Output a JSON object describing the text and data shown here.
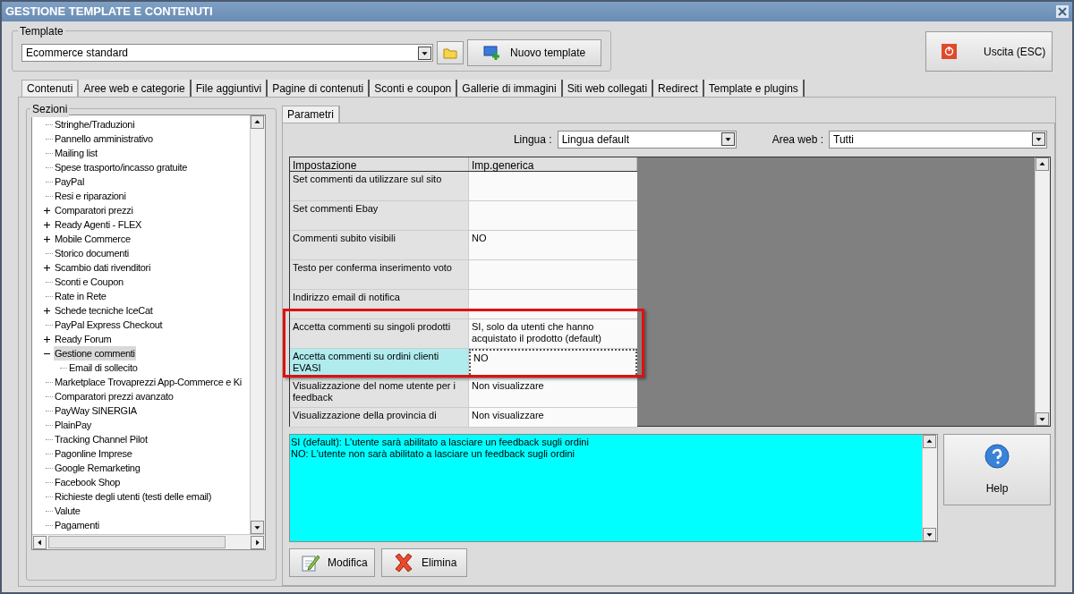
{
  "window": {
    "title": "GESTIONE TEMPLATE E CONTENUTI"
  },
  "template": {
    "label": "Template",
    "value": "Ecommerce standard",
    "new_button": "Nuovo template"
  },
  "exit_button": "Uscita (ESC)",
  "tabs": [
    {
      "label": "Contenuti",
      "selected": true
    },
    {
      "label": "Aree web e categorie",
      "selected": false
    },
    {
      "label": "File aggiuntivi",
      "selected": false
    },
    {
      "label": "Pagine di contenuti",
      "selected": false
    },
    {
      "label": "Sconti e coupon",
      "selected": false
    },
    {
      "label": "Gallerie di immagini",
      "selected": false
    },
    {
      "label": "Siti web collegati",
      "selected": false
    },
    {
      "label": "Redirect",
      "selected": false
    },
    {
      "label": "Template e plugins",
      "selected": false
    }
  ],
  "sections": {
    "label": "Sezioni",
    "items": [
      {
        "label": "Stringhe/Traduzioni",
        "kind": "leaf",
        "selected": false
      },
      {
        "label": "Pannello amministrativo",
        "kind": "leaf",
        "selected": false
      },
      {
        "label": "Mailing list",
        "kind": "leaf",
        "selected": false
      },
      {
        "label": "Spese trasporto/incasso gratuite",
        "kind": "leaf",
        "selected": false
      },
      {
        "label": "PayPal",
        "kind": "leaf",
        "selected": false
      },
      {
        "label": "Resi e riparazioni",
        "kind": "leaf",
        "selected": false
      },
      {
        "label": "Comparatori prezzi",
        "kind": "folder",
        "expanded": false,
        "selected": false
      },
      {
        "label": "Ready Agenti - FLEX",
        "kind": "folder",
        "expanded": false,
        "selected": false
      },
      {
        "label": "Mobile Commerce",
        "kind": "folder",
        "expanded": false,
        "selected": false
      },
      {
        "label": "Storico documenti",
        "kind": "leaf",
        "selected": false
      },
      {
        "label": "Scambio dati rivenditori",
        "kind": "folder",
        "expanded": false,
        "selected": false
      },
      {
        "label": "Sconti e Coupon",
        "kind": "leaf",
        "selected": false
      },
      {
        "label": "Rate in Rete",
        "kind": "leaf",
        "selected": false
      },
      {
        "label": "Schede tecniche IceCat",
        "kind": "folder",
        "expanded": false,
        "selected": false
      },
      {
        "label": "PayPal Express Checkout",
        "kind": "leaf",
        "selected": false
      },
      {
        "label": "Ready Forum",
        "kind": "folder",
        "expanded": false,
        "selected": false
      },
      {
        "label": "Gestione commenti",
        "kind": "folder",
        "expanded": true,
        "selected": true,
        "children": [
          {
            "label": "Email di sollecito",
            "kind": "leaf",
            "selected": false
          }
        ]
      },
      {
        "label": "Marketplace Trovaprezzi App-Commerce e Ki",
        "kind": "leaf",
        "selected": false
      },
      {
        "label": "Comparatori prezzi avanzato",
        "kind": "leaf",
        "selected": false
      },
      {
        "label": "PayWay SINERGIA",
        "kind": "leaf",
        "selected": false
      },
      {
        "label": "PlainPay",
        "kind": "leaf",
        "selected": false
      },
      {
        "label": "Tracking Channel Pilot",
        "kind": "leaf",
        "selected": false
      },
      {
        "label": "Pagonline Imprese",
        "kind": "leaf",
        "selected": false
      },
      {
        "label": "Google Remarketing",
        "kind": "leaf",
        "selected": false
      },
      {
        "label": "Facebook Shop",
        "kind": "leaf",
        "selected": false
      },
      {
        "label": "Richieste degli utenti (testi delle email)",
        "kind": "leaf",
        "selected": false
      },
      {
        "label": "Valute",
        "kind": "leaf",
        "selected": false
      },
      {
        "label": "Pagamenti",
        "kind": "leaf",
        "selected": false
      }
    ]
  },
  "subtabs": [
    {
      "label": "Parametri",
      "selected": true
    }
  ],
  "filters": [
    {
      "label": "Lingua :",
      "value": "Lingua default"
    },
    {
      "label": "Area web :",
      "value": "Tutti"
    }
  ],
  "grid": {
    "columns": [
      "Impostazione",
      "Imp.generica"
    ],
    "rows": [
      {
        "setting": "Set commenti da utilizzare sul sito",
        "value": "",
        "selected": false
      },
      {
        "setting": "Set commenti Ebay",
        "value": "",
        "selected": false
      },
      {
        "setting": "Commenti subito visibili",
        "value": "NO",
        "selected": false
      },
      {
        "setting": "Testo per conferma inserimento voto",
        "value": "",
        "selected": false
      },
      {
        "setting": "Indirizzo email di notifica",
        "value": "",
        "selected": false
      },
      {
        "setting": "Accetta commenti su singoli prodotti",
        "value": "SI, solo da utenti che hanno acquistato il prodotto (default)",
        "selected": false
      },
      {
        "setting": "Accetta commenti su ordini clienti EVASI",
        "value": "NO",
        "selected": true
      },
      {
        "setting": "Visualizzazione del nome utente per i feedback",
        "value": "Non visualizzare",
        "selected": false
      },
      {
        "setting": "Visualizzazione della provincia di",
        "value": "Non visualizzare",
        "selected": false
      }
    ]
  },
  "description": [
    "SI (default): L'utente sarà abilitato a lasciare un feedback sugli ordini",
    "NO: L'utente non sarà abilitato a lasciare un feedback sugli ordini"
  ],
  "help_button": "Help",
  "actions": [
    {
      "label": "Modifica",
      "kind": "edit"
    },
    {
      "label": "Elimina",
      "kind": "delete"
    }
  ]
}
